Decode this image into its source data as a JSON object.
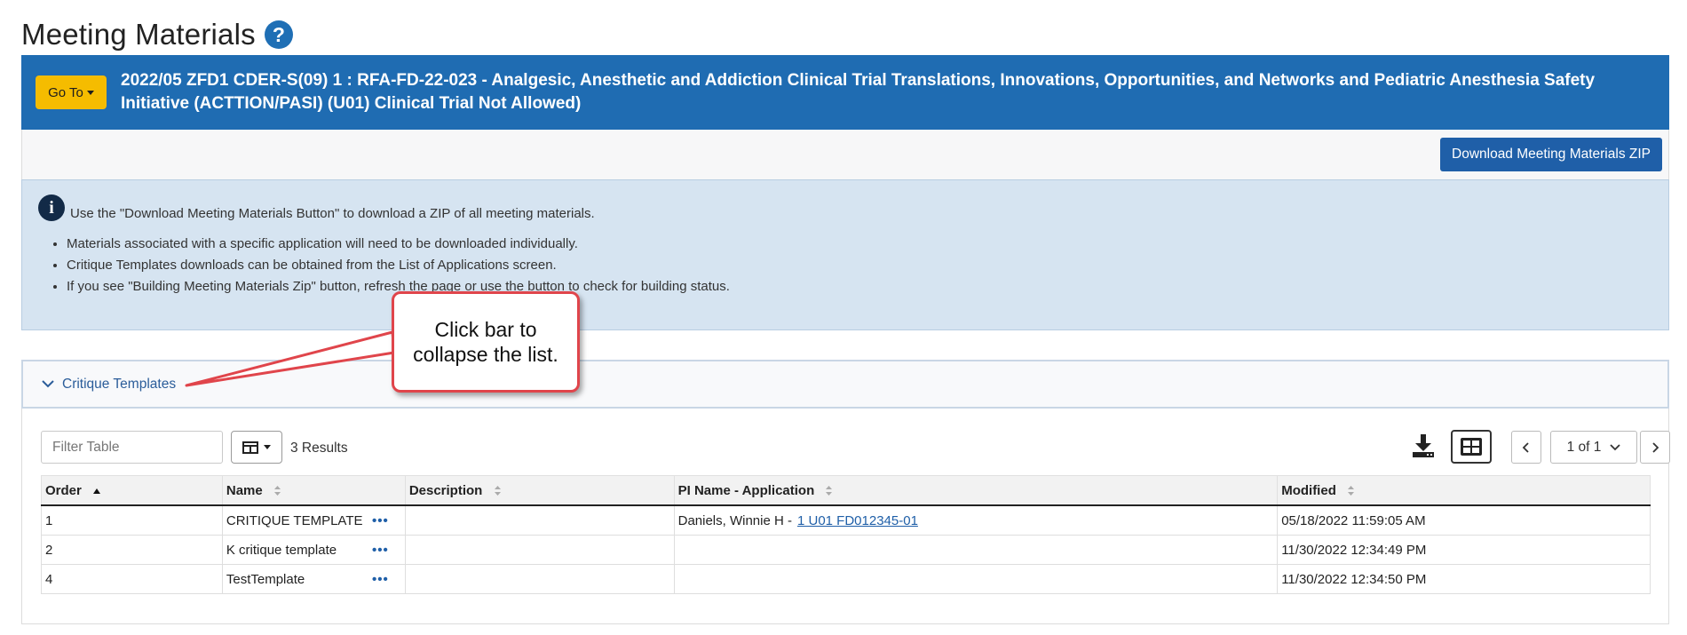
{
  "page": {
    "title": "Meeting Materials"
  },
  "banner": {
    "goto_label": "Go To",
    "meeting_title": "2022/05 ZFD1 CDER-S(09) 1 : RFA-FD-22-023 - Analgesic, Anesthetic and Addiction Clinical Trial Translations, Innovations, Opportunities, and Networks and Pediatric Anesthesia Safety Initiative (ACTTION/PASI) (U01) Clinical Trial Not Allowed)"
  },
  "toolbar": {
    "download_zip_label": "Download Meeting Materials ZIP"
  },
  "info": {
    "lead": "Use the \"Download Meeting Materials Button\" to download a ZIP of all meeting materials.",
    "bullets": [
      "Materials associated with a specific application will need to be downloaded individually.",
      "Critique Templates downloads can be obtained from the List of Applications screen.",
      "If you see \"Building Meeting Materials Zip\" button, refresh the page or use the button to check for building status."
    ]
  },
  "callout": {
    "text": "Click bar to collapse the list."
  },
  "section": {
    "title": "Critique Templates",
    "filter_placeholder": "Filter Table",
    "results": "3 Results",
    "page_indicator": "1 of 1",
    "columns": [
      "Order",
      "Name",
      "Description",
      "PI Name - Application",
      "Modified"
    ],
    "rows": [
      {
        "order": "1",
        "name": "CRITIQUE TEMPLATE",
        "description": "",
        "pi_name": "Daniels, Winnie H -",
        "application": "1 U01 FD012345-01",
        "modified": "05/18/2022 11:59:05 AM"
      },
      {
        "order": "2",
        "name": "K critique template",
        "description": "",
        "pi_name": "",
        "application": "",
        "modified": "11/30/2022 12:34:49 PM"
      },
      {
        "order": "4",
        "name": "TestTemplate",
        "description": "",
        "pi_name": "",
        "application": "",
        "modified": "11/30/2022 12:34:50 PM"
      }
    ],
    "row_action": "•••"
  },
  "colors": {
    "banner": "#1f6cb2",
    "goto": "#f5bc00",
    "info_bg": "#d6e4f1",
    "callout_border": "#e0454b"
  }
}
